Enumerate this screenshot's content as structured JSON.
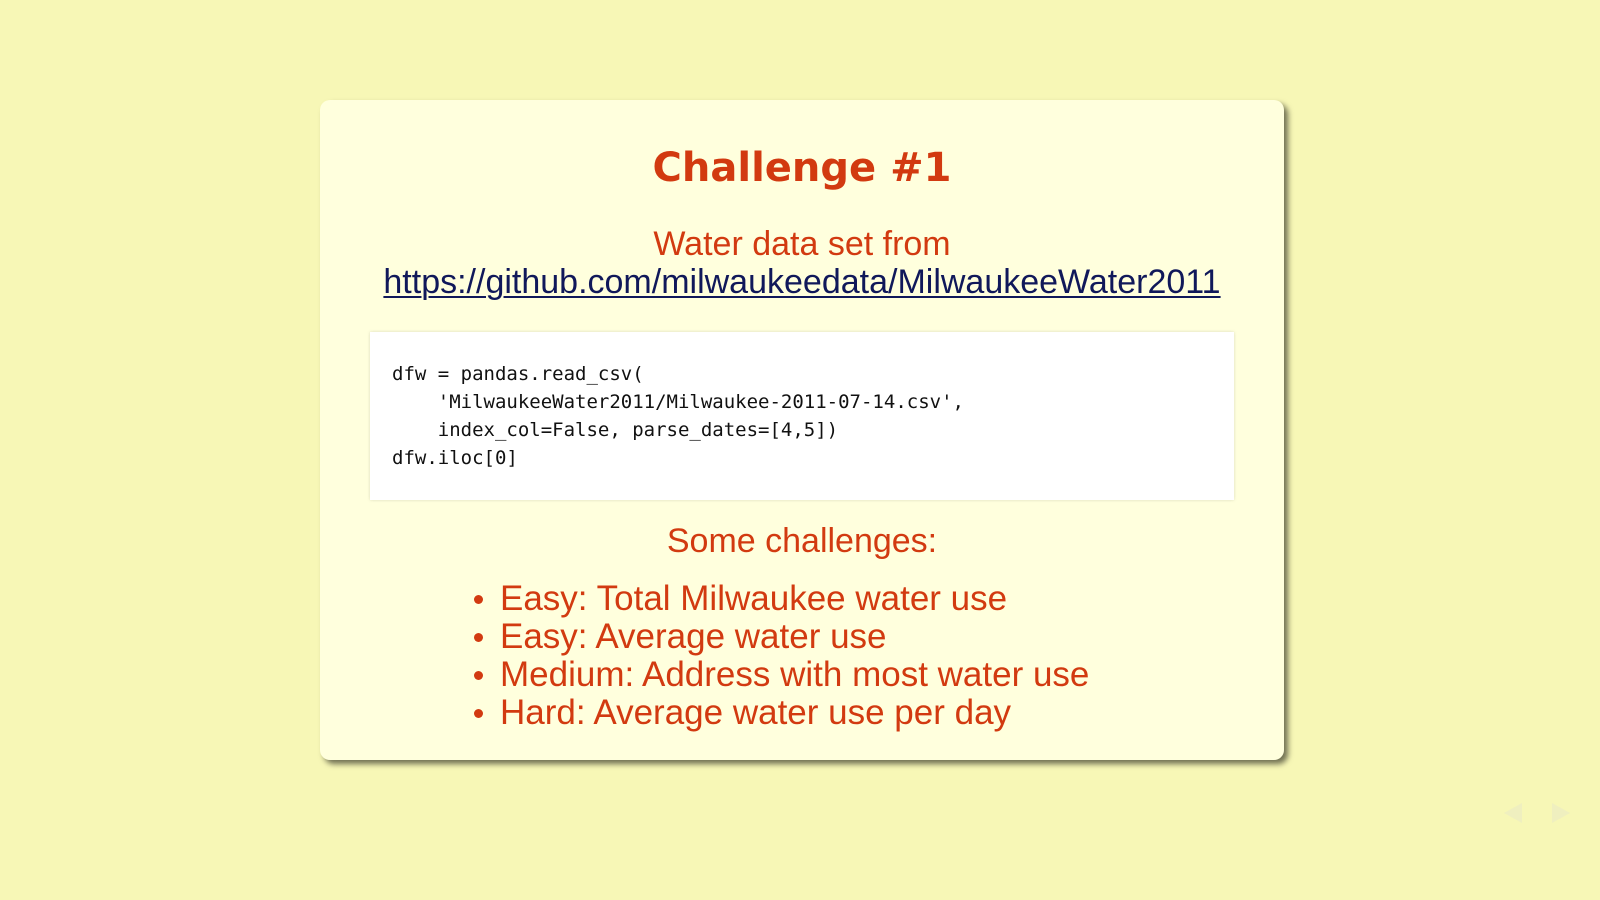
{
  "slide": {
    "title": "Challenge #1",
    "source_text": "Water data set from",
    "source_link": "https://github.com/milwaukeedata/MilwaukeeWater2011",
    "code": "dfw = pandas.read_csv(\n    'MilwaukeeWater2011/Milwaukee-2011-07-14.csv',\n    index_col=False, parse_dates=[4,5])\ndfw.iloc[0]",
    "subheading": "Some challenges:",
    "challenges": [
      "Easy: Total Milwaukee water use",
      "Easy: Average water use",
      "Medium: Address with most water use",
      "Hard: Average water use per day"
    ]
  },
  "navigation": {
    "prev_icon": "triangle-left-icon",
    "next_icon": "triangle-right-icon"
  },
  "colors": {
    "background": "#f7f7b6",
    "slide": "#ffffdd",
    "accent": "#d23a10",
    "link": "#10185a"
  }
}
